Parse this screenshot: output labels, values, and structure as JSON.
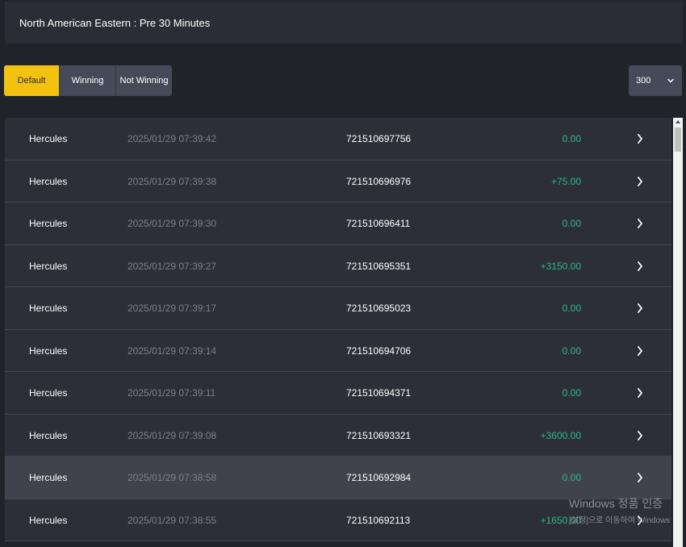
{
  "header": {
    "title": "North American Eastern : Pre 30 Minutes"
  },
  "filters": {
    "default_label": "Default",
    "winning_label": "Winning",
    "not_winning_label": "Not Winning",
    "active": "Default"
  },
  "count_select": {
    "value": "300",
    "icon": "chevron-down-icon"
  },
  "rows": [
    {
      "name": "Hercules",
      "time": "2025/01/29 07:39:42",
      "id": "721510697756",
      "amount": "0.00"
    },
    {
      "name": "Hercules",
      "time": "2025/01/29 07:39:38",
      "id": "721510696976",
      "amount": "+75.00"
    },
    {
      "name": "Hercules",
      "time": "2025/01/29 07:39:30",
      "id": "721510696411",
      "amount": "0.00"
    },
    {
      "name": "Hercules",
      "time": "2025/01/29 07:39:27",
      "id": "721510695351",
      "amount": "+3150.00"
    },
    {
      "name": "Hercules",
      "time": "2025/01/29 07:39:17",
      "id": "721510695023",
      "amount": "0.00"
    },
    {
      "name": "Hercules",
      "time": "2025/01/29 07:39:14",
      "id": "721510694706",
      "amount": "0.00"
    },
    {
      "name": "Hercules",
      "time": "2025/01/29 07:39:11",
      "id": "721510694371",
      "amount": "0.00"
    },
    {
      "name": "Hercules",
      "time": "2025/01/29 07:39:08",
      "id": "721510693321",
      "amount": "+3600.00"
    },
    {
      "name": "Hercules",
      "time": "2025/01/29 07:38:58",
      "id": "721510692984",
      "amount": "0.00"
    },
    {
      "name": "Hercules",
      "time": "2025/01/29 07:38:55",
      "id": "721510692113",
      "amount": "+1650.00"
    }
  ],
  "colors": {
    "accent": "#f3c211",
    "positive": "#2db886",
    "row_background": "#2d2f38",
    "row_hover": "#40434e"
  },
  "watermark": {
    "title": "Windows 정품 인증",
    "subtitle": "[설정]으로 이동하여 Windows"
  }
}
